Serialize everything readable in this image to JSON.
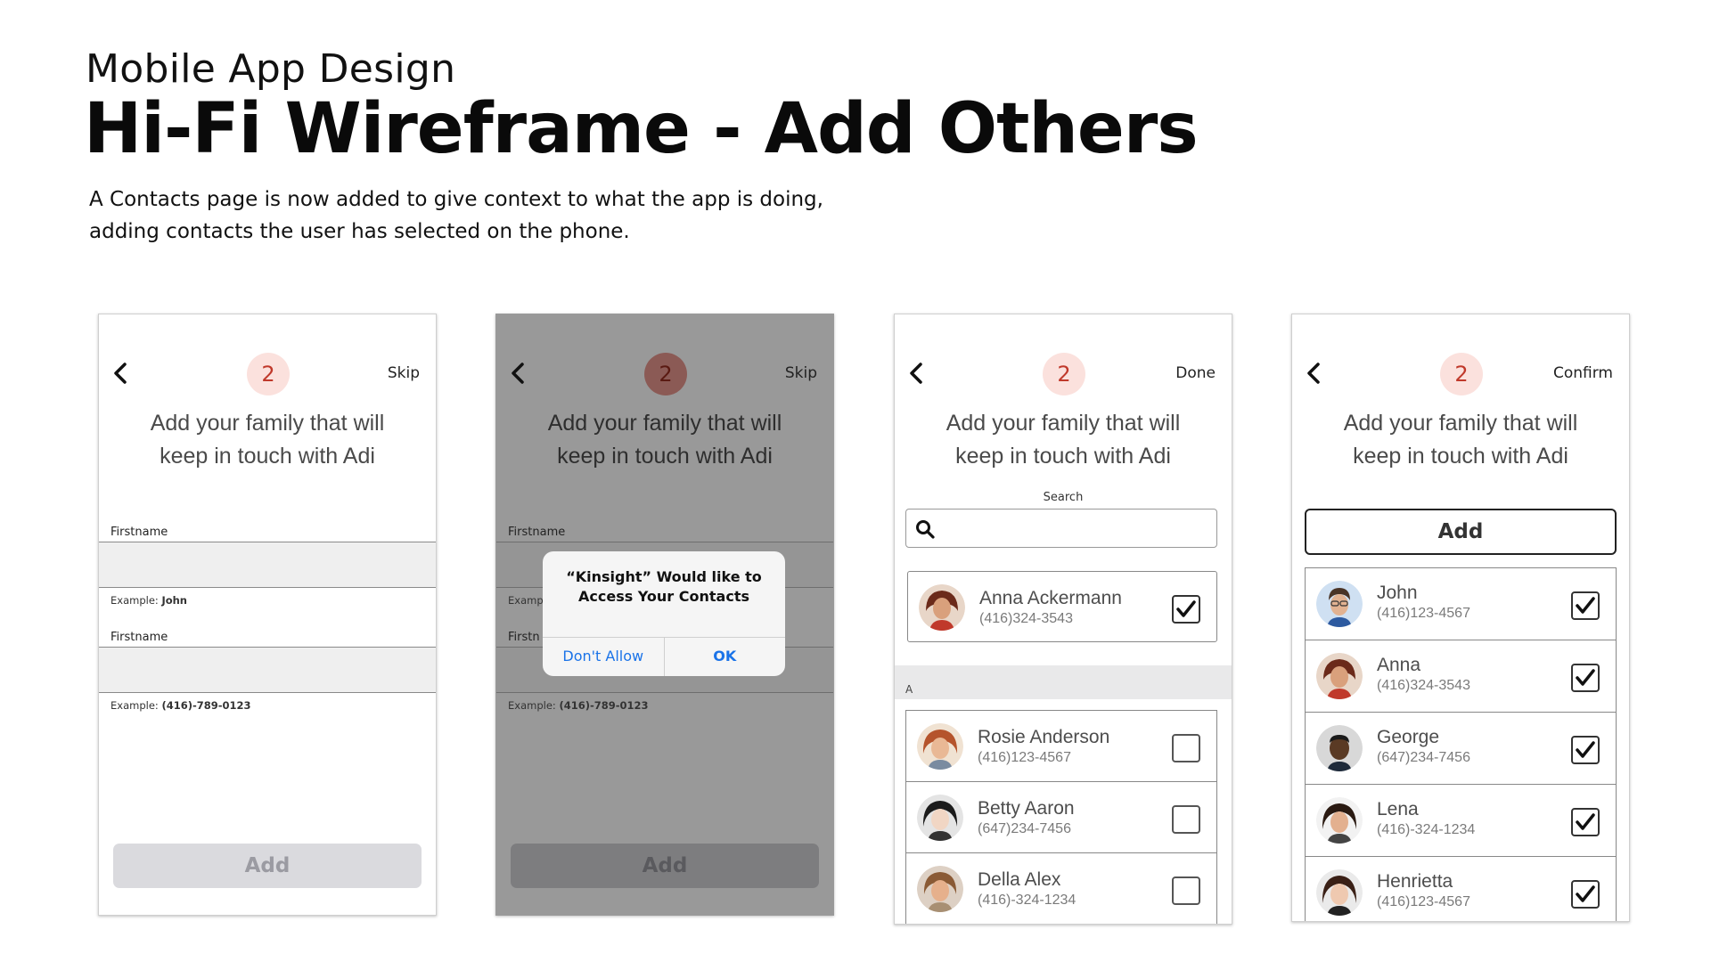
{
  "header": {
    "subtitle": "Mobile App Design",
    "title": "Hi-Fi Wireframe - Add Others",
    "description": "A Contacts page is now added to give context to what the app is doing, adding contacts the user has selected on the phone."
  },
  "colors": {
    "badge_bg": "#fbe1dd",
    "badge_text": "#c0392b",
    "link_blue": "#1a73e8",
    "overlay": "#999999"
  },
  "screens": [
    {
      "step": "2",
      "top_right": "Skip",
      "headline_line1": "Add your family that will",
      "headline_line2": "keep in touch with Adi",
      "field1_label": "Firstname",
      "field1_example_prefix": "Example:",
      "field1_example_value": "John",
      "field2_label": "Firstname",
      "field2_example_prefix": "Example:",
      "field2_example_value": "(416)-789-0123",
      "add_label": "Add"
    },
    {
      "step": "2",
      "top_right": "Skip",
      "headline_line1": "Add your family that will",
      "headline_line2": "keep in touch with Adi",
      "field1_label": "Firstname",
      "field1_example_prefix": "Examp",
      "field2_label": "Firstn",
      "field2_example_prefix": "Example:",
      "field2_example_value": "(416)-789-0123",
      "add_label": "Add",
      "dialog": {
        "line1": "“Kinsight” Would like to",
        "line2": "Access Your Contacts",
        "deny": "Don't Allow",
        "ok": "OK"
      }
    },
    {
      "step": "2",
      "top_right": "Done",
      "headline_line1": "Add your family that will",
      "headline_line2": "keep in touch with Adi",
      "search_label": "Search",
      "search_value": "",
      "selected": {
        "name": "Anna Ackermann",
        "phone": "(416)324-3543",
        "checked": true,
        "avatar_icon": "woman-avatar-icon"
      },
      "section_letter": "A",
      "contacts": [
        {
          "name": "Rosie Anderson",
          "phone": "(416)123-4567",
          "checked": false,
          "avatar_icon": "woman-avatar-icon"
        },
        {
          "name": "Betty Aaron",
          "phone": "(647)234-7456",
          "checked": false,
          "avatar_icon": "woman-avatar-icon"
        },
        {
          "name": "Della Alex",
          "phone": "(416)-324-1234",
          "checked": false,
          "avatar_icon": "woman-avatar-icon"
        }
      ]
    },
    {
      "step": "2",
      "top_right": "Confirm",
      "headline_line1": "Add your family that will",
      "headline_line2": "keep in touch with Adi",
      "add_label": "Add",
      "contacts": [
        {
          "name": "John",
          "phone": "(416)123-4567",
          "checked": true,
          "avatar_icon": "man-avatar-icon"
        },
        {
          "name": "Anna",
          "phone": "(416)324-3543",
          "checked": true,
          "avatar_icon": "woman-avatar-icon"
        },
        {
          "name": "George",
          "phone": "(647)234-7456",
          "checked": true,
          "avatar_icon": "man-avatar-icon"
        },
        {
          "name": "Lena",
          "phone": "(416)-324-1234",
          "checked": true,
          "avatar_icon": "woman-avatar-icon"
        },
        {
          "name": "Henrietta",
          "phone": "(416)123-4567",
          "checked": true,
          "avatar_icon": "woman-avatar-icon"
        }
      ]
    }
  ]
}
